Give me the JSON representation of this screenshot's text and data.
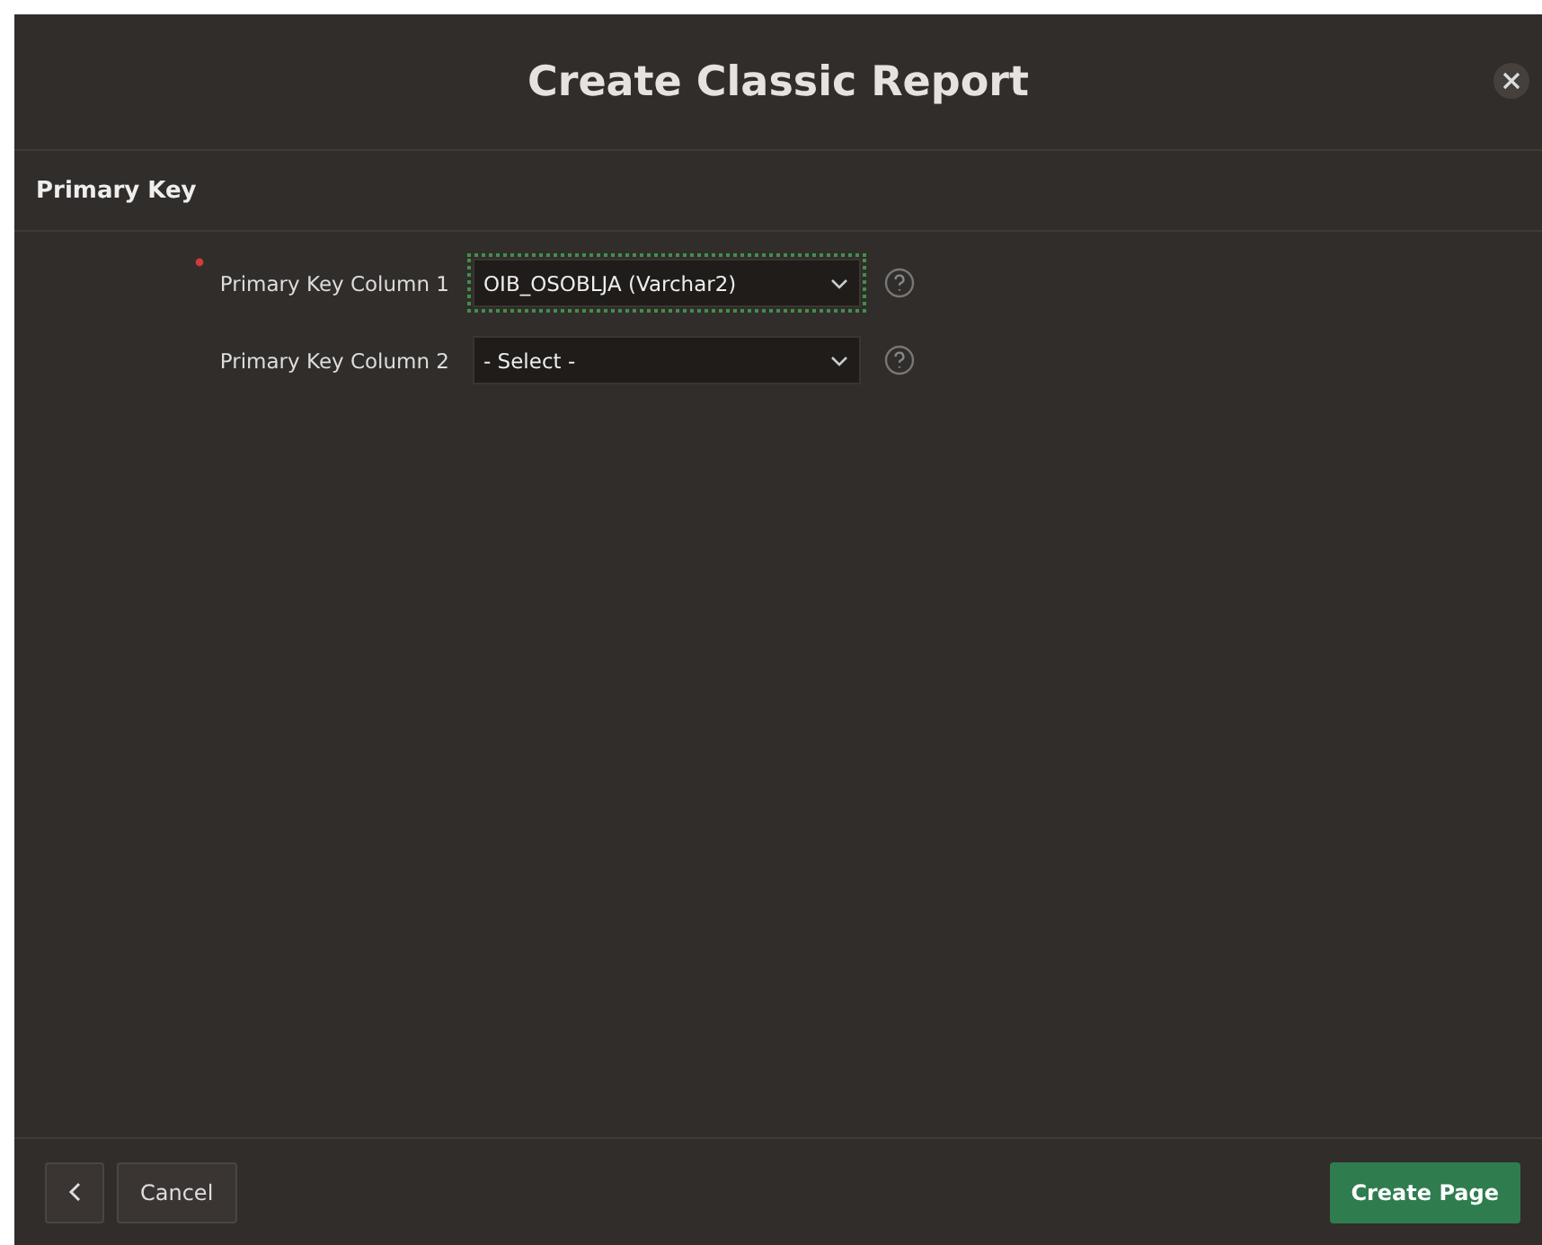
{
  "dialog": {
    "title": "Create Classic Report"
  },
  "section": {
    "title": "Primary Key"
  },
  "fields": [
    {
      "label": "Primary Key Column 1",
      "value": "OIB_OSOBLJA (Varchar2)",
      "required": true,
      "focused": true
    },
    {
      "label": "Primary Key Column 2",
      "value": "- Select -",
      "required": false,
      "focused": false
    }
  ],
  "footer": {
    "cancel": "Cancel",
    "create": "Create Page"
  }
}
